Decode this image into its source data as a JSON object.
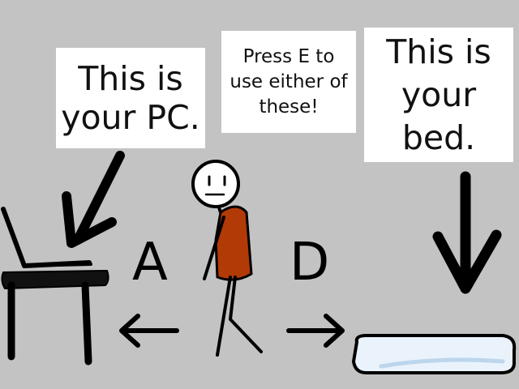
{
  "bubbles": {
    "pc": "This is\nyour PC.",
    "interact": "Press E to\nuse either of\nthese!",
    "bed": "This is\nyour\nbed."
  },
  "keys": {
    "left": "A",
    "right": "D"
  },
  "colors": {
    "background": "#c3c3c3",
    "shirt": "#b23a06",
    "bed": "#eaf2fb",
    "bed_shadow": "#bcd6ec"
  }
}
